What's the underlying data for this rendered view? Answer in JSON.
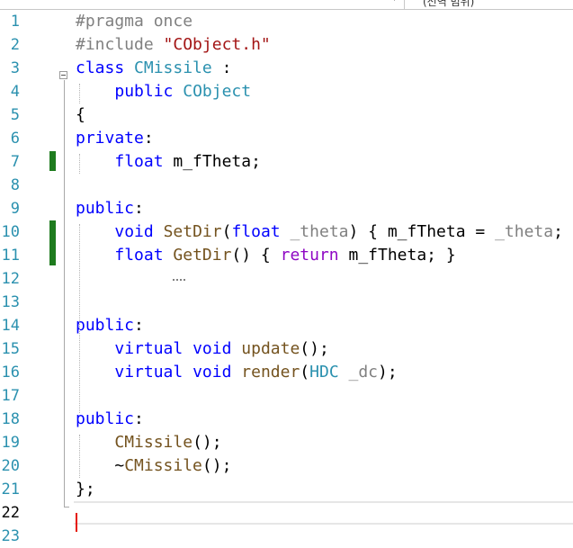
{
  "topbar": {
    "dropdown_arrow": "▾",
    "scope_text": "(전역 범위)"
  },
  "editor": {
    "current_line": 22,
    "lines": [
      {
        "n": "1",
        "tokens": [
          {
            "c": "pp",
            "t": "#pragma once"
          }
        ]
      },
      {
        "n": "2",
        "tokens": [
          {
            "c": "pp",
            "t": "#include "
          },
          {
            "c": "st",
            "t": "\"CObject.h\""
          }
        ]
      },
      {
        "n": "3",
        "tokens": [
          {
            "c": "kw",
            "t": "class"
          },
          {
            "c": "ch",
            "t": " "
          },
          {
            "c": "ty",
            "t": "CMissile"
          },
          {
            "c": "ch",
            "t": " :"
          }
        ]
      },
      {
        "n": "4",
        "tokens": [
          {
            "c": "ch",
            "t": "    "
          },
          {
            "c": "kw",
            "t": "public"
          },
          {
            "c": "ch",
            "t": " "
          },
          {
            "c": "ty",
            "t": "CObject"
          }
        ]
      },
      {
        "n": "5",
        "tokens": [
          {
            "c": "ch",
            "t": "{"
          }
        ]
      },
      {
        "n": "6",
        "tokens": [
          {
            "c": "kw",
            "t": "private"
          },
          {
            "c": "ch",
            "t": ":"
          }
        ]
      },
      {
        "n": "7",
        "tokens": [
          {
            "c": "ch",
            "t": "    "
          },
          {
            "c": "kw",
            "t": "float"
          },
          {
            "c": "ch",
            "t": " m_fTheta;"
          }
        ]
      },
      {
        "n": "8",
        "tokens": []
      },
      {
        "n": "9",
        "tokens": [
          {
            "c": "kw",
            "t": "public"
          },
          {
            "c": "ch",
            "t": ":"
          }
        ]
      },
      {
        "n": "10",
        "tokens": [
          {
            "c": "ch",
            "t": "    "
          },
          {
            "c": "kw",
            "t": "void"
          },
          {
            "c": "ch",
            "t": " "
          },
          {
            "c": "fn",
            "t": "SetDir"
          },
          {
            "c": "ch",
            "t": "("
          },
          {
            "c": "kw",
            "t": "float"
          },
          {
            "c": "ch",
            "t": " "
          },
          {
            "c": "pa",
            "t": "_theta"
          },
          {
            "c": "ch",
            "t": ") { m_fTheta = "
          },
          {
            "c": "pa",
            "t": "_theta"
          },
          {
            "c": "ch",
            "t": "; }"
          }
        ]
      },
      {
        "n": "11",
        "tokens": [
          {
            "c": "ch",
            "t": "    "
          },
          {
            "c": "kw",
            "t": "float"
          },
          {
            "c": "ch",
            "t": " "
          },
          {
            "c": "fn",
            "t": "GetDir"
          },
          {
            "c": "ch",
            "t": "() { "
          },
          {
            "c": "cf",
            "t": "return"
          },
          {
            "c": "ch",
            "t": " m_fTheta; }"
          }
        ]
      },
      {
        "n": "12",
        "tokens": []
      },
      {
        "n": "13",
        "tokens": []
      },
      {
        "n": "14",
        "tokens": [
          {
            "c": "kw",
            "t": "public"
          },
          {
            "c": "ch",
            "t": ":"
          }
        ]
      },
      {
        "n": "15",
        "tokens": [
          {
            "c": "ch",
            "t": "    "
          },
          {
            "c": "kw",
            "t": "virtual"
          },
          {
            "c": "ch",
            "t": " "
          },
          {
            "c": "kw",
            "t": "void"
          },
          {
            "c": "ch",
            "t": " "
          },
          {
            "c": "fn",
            "t": "update"
          },
          {
            "c": "ch",
            "t": "();"
          }
        ]
      },
      {
        "n": "16",
        "tokens": [
          {
            "c": "ch",
            "t": "    "
          },
          {
            "c": "kw",
            "t": "virtual"
          },
          {
            "c": "ch",
            "t": " "
          },
          {
            "c": "kw",
            "t": "void"
          },
          {
            "c": "ch",
            "t": " "
          },
          {
            "c": "fn",
            "t": "render"
          },
          {
            "c": "ch",
            "t": "("
          },
          {
            "c": "ty",
            "t": "HDC"
          },
          {
            "c": "ch",
            "t": " "
          },
          {
            "c": "pa",
            "t": "_dc"
          },
          {
            "c": "ch",
            "t": ");"
          }
        ]
      },
      {
        "n": "17",
        "tokens": []
      },
      {
        "n": "18",
        "tokens": [
          {
            "c": "kw",
            "t": "public"
          },
          {
            "c": "ch",
            "t": ":"
          }
        ]
      },
      {
        "n": "19",
        "tokens": [
          {
            "c": "ch",
            "t": "    "
          },
          {
            "c": "fn",
            "t": "CMissile"
          },
          {
            "c": "ch",
            "t": "();"
          }
        ]
      },
      {
        "n": "20",
        "tokens": [
          {
            "c": "ch",
            "t": "    ~"
          },
          {
            "c": "fn",
            "t": "CMissile"
          },
          {
            "c": "ch",
            "t": "();"
          }
        ]
      },
      {
        "n": "21",
        "tokens": [
          {
            "c": "ch",
            "t": "};"
          }
        ]
      },
      {
        "n": "22",
        "tokens": []
      },
      {
        "n": "23",
        "tokens": []
      }
    ]
  }
}
